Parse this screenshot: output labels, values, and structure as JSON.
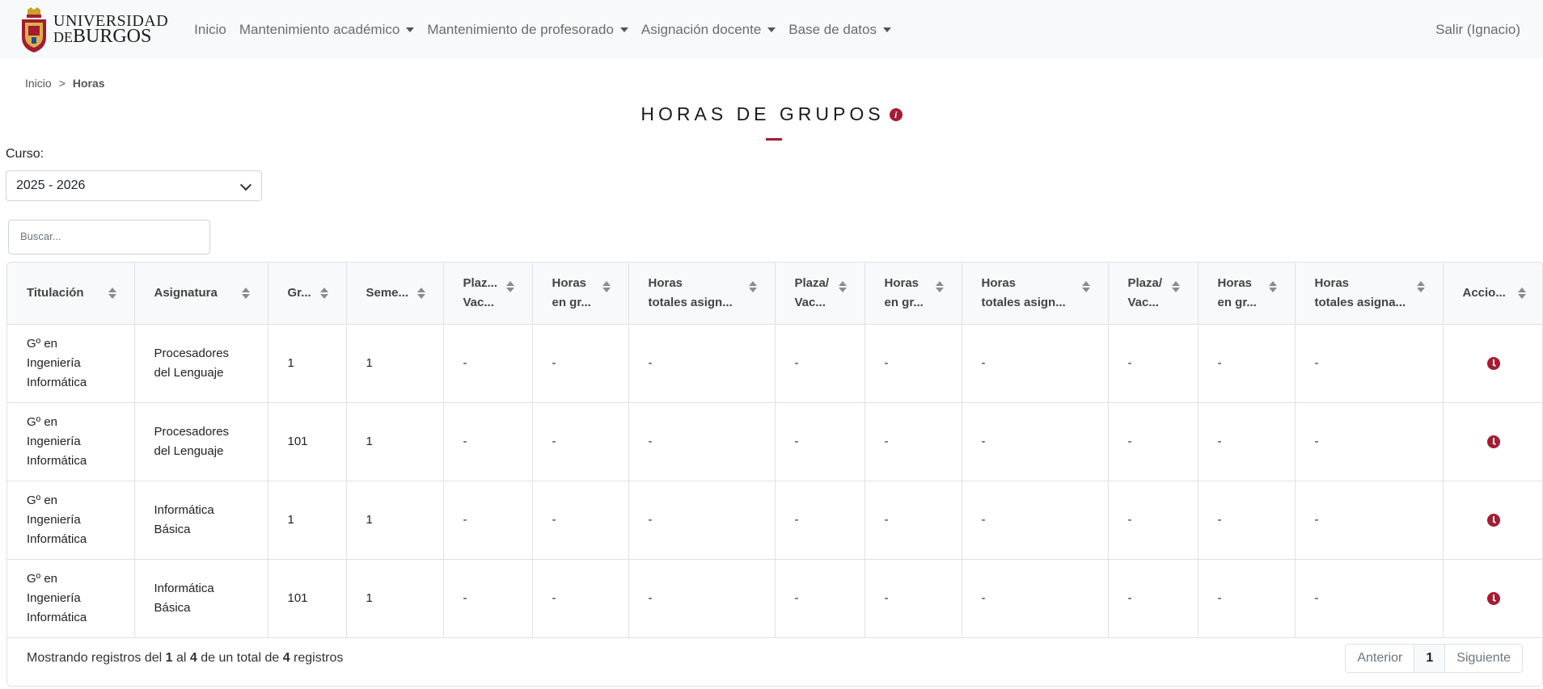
{
  "brand": {
    "line1": "UNIVERSIDAD",
    "line2_prefix": "DE",
    "line2_main": "BURGOS"
  },
  "nav": {
    "items": [
      {
        "label": "Inicio",
        "dropdown": false
      },
      {
        "label": "Mantenimiento académico",
        "dropdown": true
      },
      {
        "label": "Mantenimiento de profesorado",
        "dropdown": true
      },
      {
        "label": "Asignación docente",
        "dropdown": true
      },
      {
        "label": "Base de datos",
        "dropdown": true
      }
    ],
    "logout": "Salir (Ignacio)"
  },
  "breadcrumb": {
    "home": "Inicio",
    "separator": ">",
    "current": "Horas"
  },
  "title": "HORAS DE GRUPOS",
  "info_icon_glyph": "i",
  "curso": {
    "label": "Curso:",
    "selected": "2025 - 2026"
  },
  "search": {
    "placeholder": "Buscar..."
  },
  "table": {
    "headers": [
      [
        "Titulación"
      ],
      [
        "Asignatura"
      ],
      [
        "Gr..."
      ],
      [
        "Seme..."
      ],
      [
        "Plaz...",
        "Vac..."
      ],
      [
        "Horas",
        "en gr..."
      ],
      [
        "Horas",
        "totales asign..."
      ],
      [
        "Plaza/",
        "Vac..."
      ],
      [
        "Horas",
        "en gr..."
      ],
      [
        "Horas",
        "totales asign..."
      ],
      [
        "Plaza/",
        "Vac..."
      ],
      [
        "Horas",
        "en gr..."
      ],
      [
        "Horas",
        "totales asigna..."
      ],
      [
        "Accio..."
      ]
    ],
    "rows": [
      {
        "titulacion": [
          "Gº en",
          "Ingeniería",
          "Informática"
        ],
        "asignatura": [
          "Procesadores",
          "del Lenguaje"
        ],
        "grupo": "1",
        "semestre": "1",
        "cols": [
          "-",
          "-",
          "-",
          "-",
          "-",
          "-",
          "-",
          "-",
          "-"
        ]
      },
      {
        "titulacion": [
          "Gº en",
          "Ingeniería",
          "Informática"
        ],
        "asignatura": [
          "Procesadores",
          "del Lenguaje"
        ],
        "grupo": "101",
        "semestre": "1",
        "cols": [
          "-",
          "-",
          "-",
          "-",
          "-",
          "-",
          "-",
          "-",
          "-"
        ]
      },
      {
        "titulacion": [
          "Gº en",
          "Ingeniería",
          "Informática"
        ],
        "asignatura": [
          "Informática",
          "Básica"
        ],
        "grupo": "1",
        "semestre": "1",
        "cols": [
          "-",
          "-",
          "-",
          "-",
          "-",
          "-",
          "-",
          "-",
          "-"
        ]
      },
      {
        "titulacion": [
          "Gº en",
          "Ingeniería",
          "Informática"
        ],
        "asignatura": [
          "Informática",
          "Básica"
        ],
        "grupo": "101",
        "semestre": "1",
        "cols": [
          "-",
          "-",
          "-",
          "-",
          "-",
          "-",
          "-",
          "-",
          "-"
        ]
      }
    ],
    "action_icon": "clock-icon"
  },
  "footer": {
    "info_prefix": "Mostrando registros del",
    "from": "1",
    "mid1": "al",
    "to": "4",
    "mid2": "de un total de",
    "total": "4",
    "suffix": "registros",
    "prev": "Anterior",
    "page": "1",
    "next": "Siguiente"
  },
  "colors": {
    "accent": "#a51c30",
    "navbar_bg": "#f8f9fa"
  }
}
